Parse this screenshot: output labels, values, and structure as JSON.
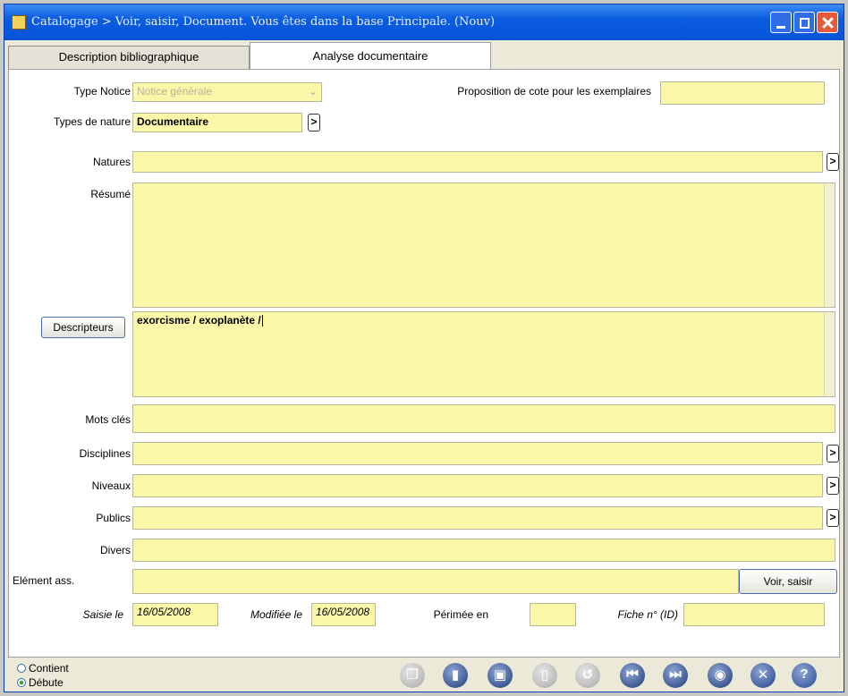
{
  "window": {
    "title": "Catalogage > Voir, saisir, Document. Vous êtes dans la base Principale. (Nouv)"
  },
  "tabs": [
    {
      "label": "Description bibliographique"
    },
    {
      "label": "Analyse documentaire"
    }
  ],
  "form": {
    "type_notice": {
      "label": "Type Notice",
      "value": "Notice générale"
    },
    "proposition_cote": {
      "label": "Proposition de cote pour les exemplaires",
      "value": ""
    },
    "types_nature": {
      "label": "Types de nature",
      "value": "Documentaire",
      "button": ">"
    },
    "natures": {
      "label": "Natures",
      "value": "",
      "button": ">"
    },
    "resume": {
      "label": "Résumé",
      "value": ""
    },
    "descripteurs": {
      "label": "Descripteurs",
      "value": "exorcisme / exoplanète /"
    },
    "mots_cles": {
      "label": "Mots clés",
      "value": ""
    },
    "disciplines": {
      "label": "Disciplines",
      "value": "",
      "button": ">"
    },
    "niveaux": {
      "label": "Niveaux",
      "value": "",
      "button": ">"
    },
    "publics": {
      "label": "Publics",
      "value": "",
      "button": ">"
    },
    "divers": {
      "label": "Divers",
      "value": ""
    },
    "element_ass": {
      "label": "Elément ass.",
      "value": "",
      "button": "Voir, saisir"
    },
    "saisie_le": {
      "label": "Saisie le",
      "value": "16/05/2008"
    },
    "modifiee_le": {
      "label": "Modifiée le",
      "value": "16/05/2008"
    },
    "perimee_en": {
      "label": "Périmée en",
      "value": ""
    },
    "fiche_no": {
      "label": "Fiche n° (ID)",
      "value": ""
    }
  },
  "search_mode": [
    {
      "label": "Contient",
      "selected": false
    },
    {
      "label": "Débute",
      "selected": true
    }
  ],
  "toolbar_icons": [
    "copy-icon",
    "eraser-icon",
    "save-icon",
    "delete-icon",
    "undo-icon",
    "first-record-icon",
    "last-record-icon",
    "view-icon",
    "close-icon",
    "help-icon"
  ],
  "colors": {
    "field_bg": "#fbf7a8",
    "titlebar": "#0653d6"
  }
}
